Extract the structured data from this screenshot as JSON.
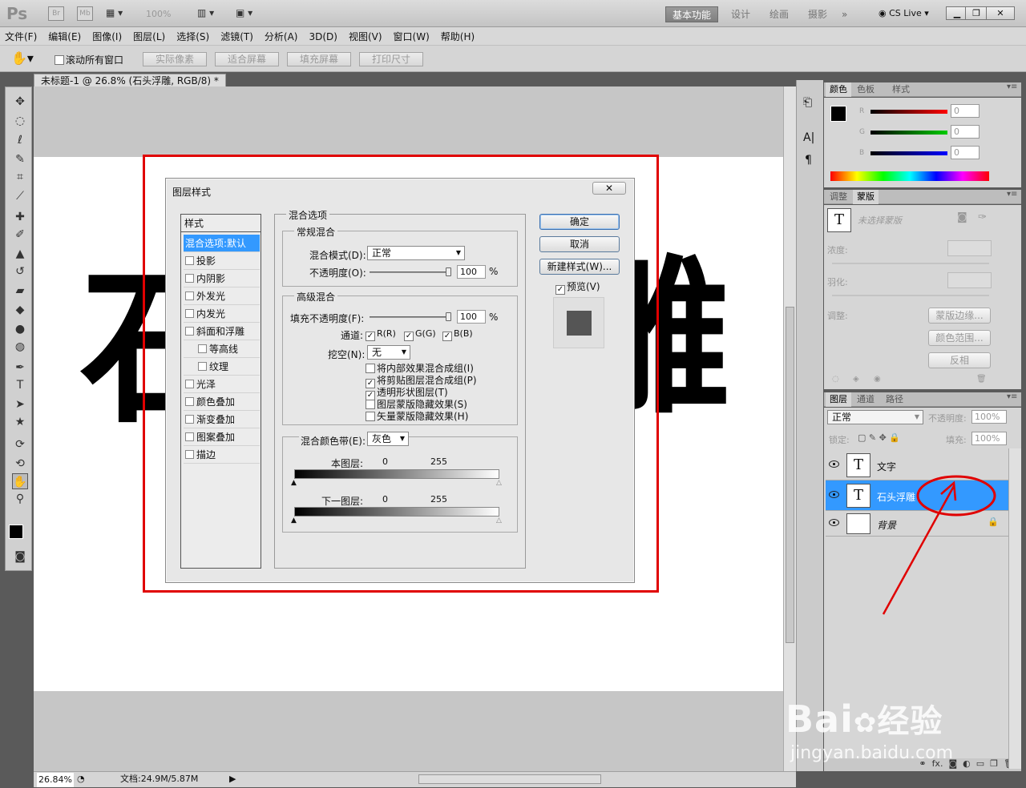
{
  "app": {
    "logo": "Ps",
    "zoom": "100%",
    "workspaces": [
      "基本功能",
      "设计",
      "绘画",
      "摄影"
    ],
    "cslive": "CS Live",
    "bridge_label": "Br",
    "minibridge_label": "Mb"
  },
  "menu": [
    "文件(F)",
    "编辑(E)",
    "图像(I)",
    "图层(L)",
    "选择(S)",
    "滤镜(T)",
    "分析(A)",
    "3D(D)",
    "视图(V)",
    "窗口(W)",
    "帮助(H)"
  ],
  "options": {
    "scroll_all": "滚动所有窗口",
    "buttons": [
      "实际像素",
      "适合屏幕",
      "填充屏幕",
      "打印尺寸"
    ]
  },
  "document": {
    "tab": "未标题-1 @ 26.8% (石头浮雕, RGB/8) *",
    "chars": [
      "石",
      "雕"
    ]
  },
  "status": {
    "zoom": "26.84%",
    "doc": "文档:24.9M/5.87M"
  },
  "dialog": {
    "title": "图层样式",
    "styles_header": "样式",
    "styles": [
      "混合选项:默认",
      "投影",
      "内阴影",
      "外发光",
      "内发光",
      "斜面和浮雕",
      "等高线",
      "纹理",
      "光泽",
      "颜色叠加",
      "渐变叠加",
      "图案叠加",
      "描边"
    ],
    "blend_options": "混合选项",
    "general": "常规混合",
    "blend_mode_label": "混合模式(D):",
    "blend_mode": "正常",
    "opacity_label": "不透明度(O):",
    "opacity": "100",
    "pct": "%",
    "advanced": "高级混合",
    "fill_label": "填充不透明度(F):",
    "fill": "100",
    "channels_label": "通道:",
    "ch_r": "R(R)",
    "ch_g": "G(G)",
    "ch_b": "B(B)",
    "knockout_label": "挖空(N):",
    "knockout": "无",
    "opts": [
      {
        "label": "将内部效果混合成组(I)",
        "checked": false
      },
      {
        "label": "将剪贴图层混合成组(P)",
        "checked": true
      },
      {
        "label": "透明形状图层(T)",
        "checked": true
      },
      {
        "label": "图层蒙版隐藏效果(S)",
        "checked": false
      },
      {
        "label": "矢量蒙版隐藏效果(H)",
        "checked": false
      }
    ],
    "blendif_label": "混合颜色带(E):",
    "blendif": "灰色",
    "this_layer": "本图层:",
    "under_layer": "下一图层:",
    "v0": "0",
    "v255": "255",
    "ok": "确定",
    "cancel": "取消",
    "new_style": "新建样式(W)...",
    "preview": "预览(V)"
  },
  "color_panel": {
    "tabs": [
      "颜色",
      "色板",
      "样式"
    ],
    "r": "R",
    "g": "G",
    "b": "B",
    "rv": "0",
    "gv": "0",
    "bv": "0"
  },
  "adjust_panel": {
    "tabs": [
      "调整",
      "蒙版"
    ],
    "mask_status": "未选择蒙版",
    "density": "浓度:",
    "feather": "羽化:",
    "refine": "调整:",
    "btn_edge": "蒙版边缘...",
    "btn_range": "颜色范围...",
    "btn_invert": "反相"
  },
  "layers_panel": {
    "tabs": [
      "图层",
      "通道",
      "路径"
    ],
    "mode": "正常",
    "opacity_label": "不透明度:",
    "opacity": "100%",
    "lock_label": "锁定:",
    "fill_label": "填充:",
    "fill": "100%",
    "layers": [
      {
        "name": "文字",
        "thumb": "T"
      },
      {
        "name": "石头浮雕",
        "thumb": "T",
        "selected": true
      },
      {
        "name": "背景",
        "thumb": ""
      }
    ]
  },
  "watermark": {
    "brand": "Bai",
    "brand2": "经验",
    "url": "jingyan.baidu.com"
  },
  "colors": {
    "red": "#e00000",
    "select": "#3399ff"
  }
}
